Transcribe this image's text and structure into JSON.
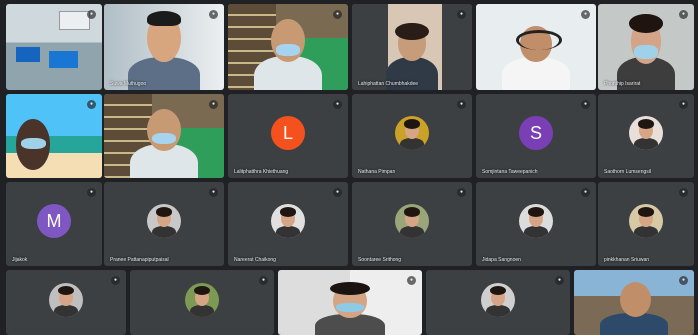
{
  "meeting": {
    "participants": [
      {
        "id": "p1",
        "name": "",
        "type": "video",
        "scene": "classroom"
      },
      {
        "id": "p2",
        "name": "Suwa Muthugoo",
        "type": "video",
        "scene": "man-glasses"
      },
      {
        "id": "p3",
        "name": "",
        "type": "video",
        "scene": "man-mask-shelf"
      },
      {
        "id": "p4",
        "name": "Lahiphattan Chumbhakdee",
        "type": "video",
        "scene": "woman-door"
      },
      {
        "id": "p5",
        "name": "",
        "type": "video",
        "scene": "man-headset"
      },
      {
        "id": "p6",
        "name": "Phonthip Isarirat",
        "type": "video",
        "scene": "woman-mask"
      },
      {
        "id": "p7",
        "name": "",
        "type": "video",
        "scene": "beach"
      },
      {
        "id": "p8",
        "name": "",
        "type": "video",
        "scene": "man-mask-shelf2"
      },
      {
        "id": "p9",
        "name": "Lalitphatthra Khiethuang",
        "type": "letter",
        "letter": "L",
        "color": "#f4511e"
      },
      {
        "id": "p10",
        "name": "Nathana Pimpan",
        "type": "photo",
        "photoBg": "#c9a227"
      },
      {
        "id": "p11",
        "name": "Somjintana Taweepanich",
        "type": "letter",
        "letter": "S",
        "color": "#7b3fb5"
      },
      {
        "id": "p12",
        "name": "Saothorn Lumsengsil",
        "type": "photo",
        "photoBg": "#e8e0d8"
      },
      {
        "id": "p13",
        "name": "Jijakok",
        "type": "letter",
        "letter": "M",
        "color": "#7e57c2"
      },
      {
        "id": "p14",
        "name": "Pranee Pattanapiputpaisal",
        "type": "photo",
        "photoBg": "#c8c8c8"
      },
      {
        "id": "p15",
        "name": "Nareerat Chaikong",
        "type": "photo",
        "photoBg": "#e0e0e0"
      },
      {
        "id": "p16",
        "name": "Soontaree Srithong",
        "type": "photo",
        "photoBg": "#9aa67a"
      },
      {
        "id": "p17",
        "name": "Jidapa Sangnoen",
        "type": "photo",
        "photoBg": "#dcdcdc"
      },
      {
        "id": "p18",
        "name": "pinkkhanan Sriuwan",
        "type": "photo",
        "photoBg": "#d7c9a6"
      },
      {
        "id": "p19",
        "name": "",
        "type": "photo",
        "photoBg": "#bfbfbf"
      },
      {
        "id": "p20",
        "name": "",
        "type": "photo",
        "photoBg": "#7d9a55"
      },
      {
        "id": "p21",
        "name": "",
        "type": "video",
        "scene": "woman-mask-room"
      },
      {
        "id": "p22",
        "name": "",
        "type": "photo",
        "photoBg": "#cfcfcf"
      },
      {
        "id": "p23",
        "name": "",
        "type": "video",
        "scene": "man-outdoor"
      }
    ],
    "mic_icon": "mic-off-icon",
    "colors": {
      "background": "#202124",
      "tile": "#3c4043",
      "name_text": "#e8eaed"
    }
  }
}
